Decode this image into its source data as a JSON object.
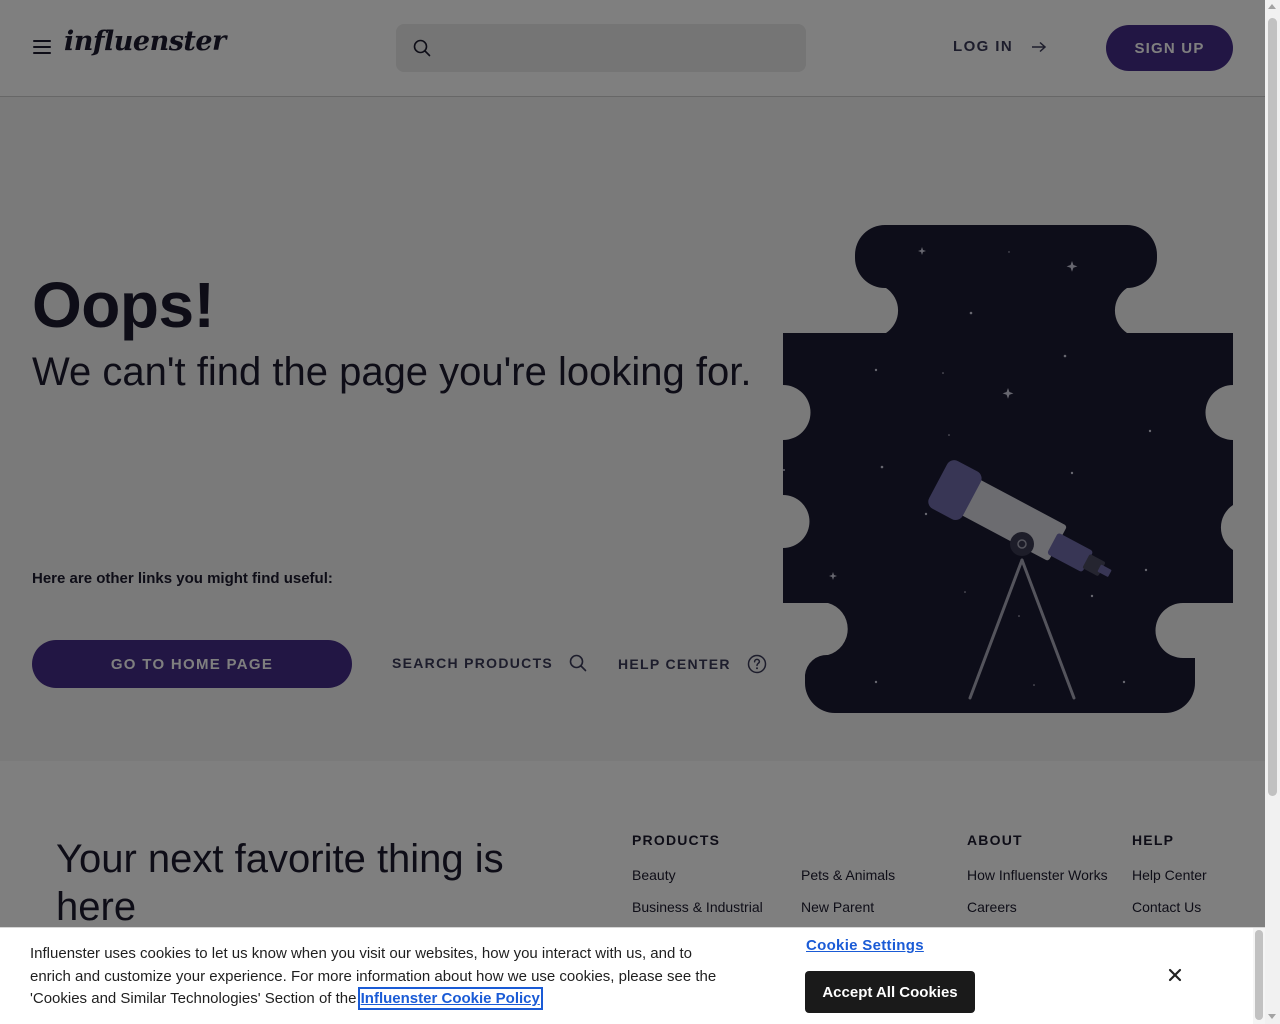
{
  "header": {
    "logo": "influenster",
    "search_placeholder": "",
    "login_label": "LOG IN",
    "signup_label": "SIGN UP"
  },
  "main": {
    "heading": "Oops!",
    "subheading": "We can't find the page you're looking for.",
    "links_label": "Here are other links you might find useful:",
    "home_button": "GO TO HOME PAGE",
    "search_products": "SEARCH PRODUCTS",
    "help_center": "HELP CENTER"
  },
  "footer": {
    "title": "Your next favorite thing is here",
    "columns": [
      {
        "heading": "PRODUCTS",
        "links": [
          "Beauty",
          "Business & Industrial"
        ]
      },
      {
        "heading": "",
        "links": [
          "Pets & Animals",
          "New Parent"
        ]
      },
      {
        "heading": "ABOUT",
        "links": [
          "How Influenster Works",
          "Careers"
        ]
      },
      {
        "heading": "HELP",
        "links": [
          "Help Center",
          "Contact Us"
        ]
      }
    ]
  },
  "cookie_banner": {
    "text": "Influenster uses cookies to let us know when you visit our websites, how you interact with us, and to enrich and customize your experience. For more information about how we use cookies, please see the 'Cookies and Similar Technologies' Section of the ",
    "policy_link": "Influenster Cookie Policy",
    "settings_label": "Cookie Settings",
    "accept_label": "Accept All Cookies"
  },
  "colors": {
    "brand_purple": "#452c88",
    "night_navy": "#1b1a33",
    "telescope_lavender": "#716cab",
    "link_blue": "#1a5bd6"
  },
  "icons": [
    "menu-icon",
    "search-icon",
    "arrow-right-icon",
    "question-circle-icon",
    "close-icon",
    "telescope-illustration"
  ]
}
